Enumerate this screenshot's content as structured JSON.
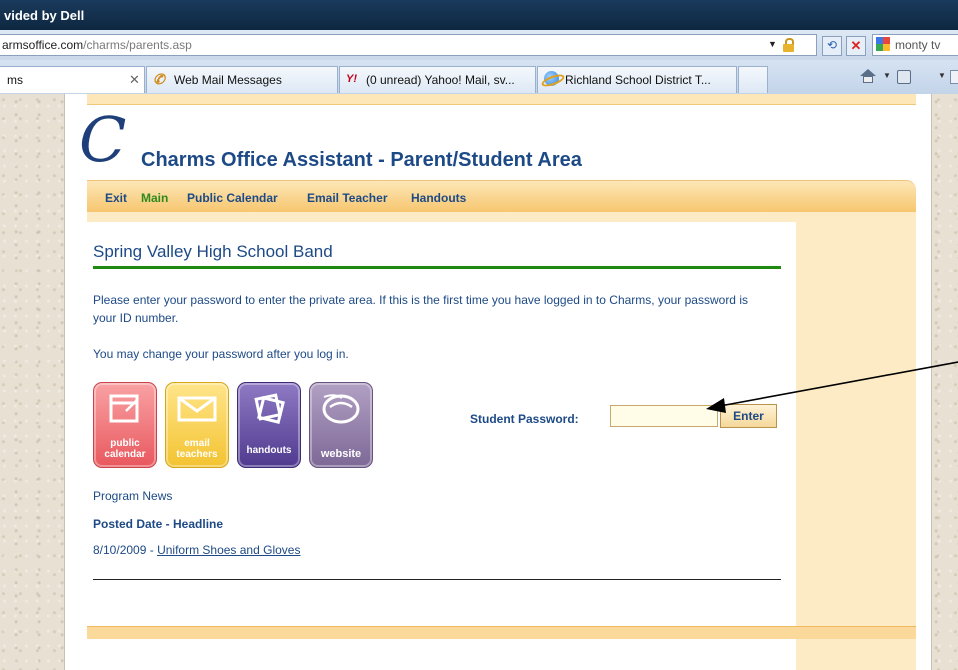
{
  "window": {
    "title_partial": "vided by Dell"
  },
  "address_bar": {
    "url_host": "armsoffice.com",
    "url_path": "/charms/parents.asp",
    "search_text": "monty tv"
  },
  "tabs": [
    {
      "label": "ms",
      "close": "✕"
    },
    {
      "label": "Web Mail Messages"
    },
    {
      "label": "(0 unread) Yahoo! Mail, sv..."
    },
    {
      "label": "Richland School District T..."
    }
  ],
  "toolbar_icons": [
    "home-icon",
    "feeds-icon",
    "print-icon"
  ],
  "page": {
    "logo_letter": "C",
    "app_title": "Charms Office Assistant - Parent/Student Area",
    "nav": [
      {
        "label": "Exit"
      },
      {
        "label": "Main"
      },
      {
        "label": "Public Calendar"
      },
      {
        "label": "Email Teacher"
      },
      {
        "label": "Handouts"
      }
    ],
    "school_title": "Spring Valley High School Band",
    "instructions": "Please enter your password to enter the private area. If this is the first time you have logged in to Charms, your password is your ID number.",
    "change_note": "You may change your password after you log in.",
    "tiles": {
      "calendar": {
        "line1": "public",
        "line2": "calendar"
      },
      "email": {
        "line1": "email",
        "line2": "teachers"
      },
      "handouts": {
        "line1": "handouts"
      },
      "website": {
        "line1": "website"
      }
    },
    "password": {
      "label": "Student Password:",
      "value": "",
      "button": "Enter"
    },
    "news": {
      "heading": "Program News",
      "column_header": "Posted Date - Headline",
      "items": [
        {
          "date": "8/10/2009",
          "separator": " - ",
          "headline": "Uniform Shoes and Gloves"
        }
      ]
    }
  },
  "colors": {
    "link_blue": "#1d4a86",
    "nav_current_green": "#2e8a1d",
    "rule_green": "#1f8a10",
    "nav_orange": "#f6c56c"
  }
}
